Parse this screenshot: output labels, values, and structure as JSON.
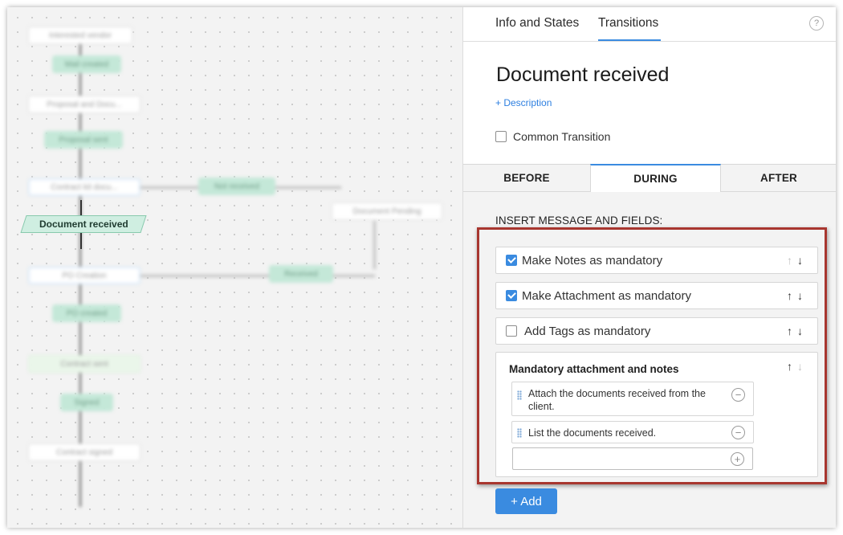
{
  "tabs": [
    {
      "label": "Info and States"
    },
    {
      "label": "Transitions"
    }
  ],
  "help_icon": "help-circle-icon",
  "transition_title": "Document received",
  "description_link": "+ Description",
  "common_transition": {
    "label": "Common Transition",
    "checked": false
  },
  "phases": [
    {
      "label": "BEFORE"
    },
    {
      "label": "DURING"
    },
    {
      "label": "AFTER"
    }
  ],
  "active_phase": "DURING",
  "section_label": "INSERT MESSAGE AND FIELDS:",
  "items": [
    {
      "label": "Make Notes as mandatory",
      "checked": true
    },
    {
      "label": "Make Attachment as mandatory",
      "checked": true
    },
    {
      "label": "Add Tags as mandatory",
      "checked": false
    }
  ],
  "mandatory_notes": {
    "title": "Mandatory attachment and notes",
    "notes": [
      "Attach the documents received from the client.",
      "List the documents received."
    ],
    "new_note_placeholder": ""
  },
  "add_button": "+ Add",
  "canvas": {
    "current_node": "Document received"
  },
  "colors": {
    "accent": "#3a8be0",
    "highlight_border": "#a8362f",
    "current_node_fill": "#cfeee1"
  }
}
